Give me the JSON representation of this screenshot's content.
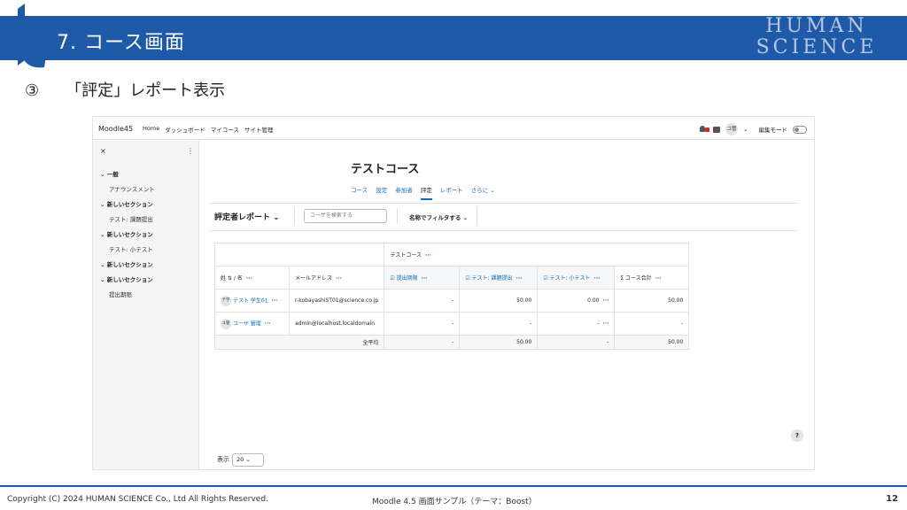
{
  "slide": {
    "title": "7. コース画面",
    "brand_line1": "HUMAN",
    "brand_line2": "SCIENCE",
    "step_number": "③",
    "step_title": "「評定」レポート表示",
    "colors": {
      "band": "#1e5aa8",
      "link": "#0f6cbf"
    }
  },
  "navbar": {
    "site_name": "Moodle45",
    "links": [
      "Home",
      "ダッシュボード",
      "マイコース",
      "サイト管理"
    ],
    "user_initials": "ユ管",
    "edit_mode_label": "編集モード"
  },
  "drawer": {
    "close": "×",
    "menu": "⋮",
    "items": [
      {
        "label": "⌄ 一般",
        "type": "section"
      },
      {
        "label": "アナウンスメント",
        "type": "sub"
      },
      {
        "label": "⌄ 新しいセクション",
        "type": "section"
      },
      {
        "label": "テスト: 課題提出",
        "type": "sub"
      },
      {
        "label": "⌄ 新しいセクション",
        "type": "section"
      },
      {
        "label": "テスト: 小テスト",
        "type": "sub"
      },
      {
        "label": "⌄ 新しいセクション",
        "type": "section"
      },
      {
        "label": "⌄ 新しいセクション",
        "type": "section"
      },
      {
        "label": "提出期限",
        "type": "sub"
      }
    ]
  },
  "course": {
    "title": "テストコース",
    "tabs": [
      "コース",
      "設定",
      "参加者",
      "評定",
      "レポート",
      "さらに ⌄"
    ],
    "active_tab": "評定"
  },
  "report": {
    "selector": "評定者レポート ⌄",
    "search_placeholder": "ユーザを検索する",
    "filter": "名称でフィルタする ⌄",
    "category_header": "テストコース",
    "columns": {
      "name": "姓 ⇅ / 名",
      "email": "メールアドレス",
      "item1": "☑ 提出期限",
      "item2": "☑ テスト: 課題提出",
      "item3": "☑ テスト: 小テスト",
      "total": "Σ コース合計"
    },
    "rows": [
      {
        "initials": "テ学",
        "name": "テスト 学生01",
        "email": "r-kobayashiST01@science.co.jp",
        "item1": "-",
        "item2": "50.00",
        "item3": "0.00",
        "total": "50.00"
      },
      {
        "initials": "ユ管",
        "name": "ユーザ 管理",
        "email": "admin@localhost.localdomain",
        "item1": "-",
        "item2": "-",
        "item3": "-",
        "total": "-"
      }
    ],
    "average": {
      "label": "全平均",
      "item1": "-",
      "item2": "50.00",
      "item3": "-",
      "total": "50.00"
    },
    "per_page_label": "表示",
    "per_page_value": "20 ⌄"
  },
  "footer": {
    "copyright": "Copyright (C) 2024 HUMAN SCIENCE Co., Ltd All Rights Reserved.",
    "center": "Moodle 4.5 画面サンプル（テーマ：Boost）",
    "page": "12"
  }
}
